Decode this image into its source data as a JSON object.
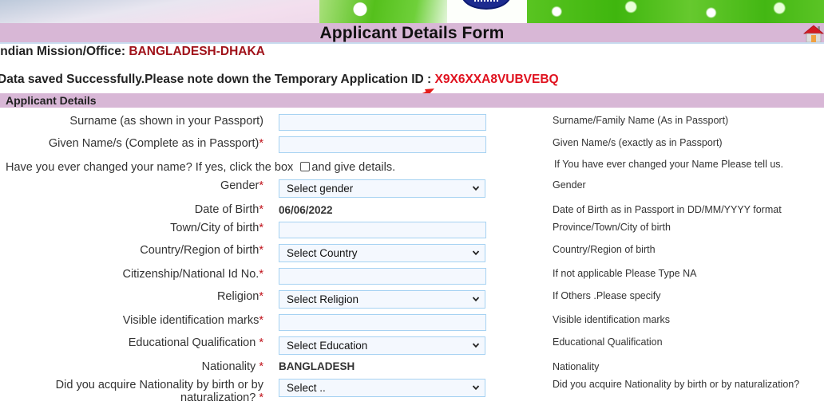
{
  "page": {
    "title": "Applicant Details Form",
    "home_icon": "home-icon"
  },
  "mission": {
    "label": "Indian Mission/Office: ",
    "value": "BANGLADESH-DHAKA"
  },
  "save_message": {
    "text": "Data saved Successfully.Please note down the Temporary Application ID : ",
    "application_id": "X9X6XXA8VUBVEBQ",
    "arrow_icon": "red-arrow-annotation"
  },
  "section": {
    "title": "Applicant Details"
  },
  "colors": {
    "accent_bar": "#d8b7d6",
    "mission_value": "#a0121a",
    "application_id": "#e0121f",
    "input_border": "#a6d2f2",
    "input_bg": "#f4f8fe"
  },
  "fields": {
    "surname": {
      "label": "Surname (as shown in your Passport)",
      "required": "",
      "value": "",
      "help": "Surname/Family Name (As in Passport)"
    },
    "given_name": {
      "label": "Given Name/s (Complete as in Passport)",
      "required": "*",
      "value": "",
      "help": "Given Name/s (exactly as in Passport)"
    },
    "name_changed": {
      "label_before": "Have you ever changed your name? If yes, click the box ",
      "label_after": "and give details.",
      "checked": false,
      "help": "If You have ever changed your Name Please tell us."
    },
    "gender": {
      "label": "Gender",
      "required": "*",
      "selected": "Select gender",
      "help": "Gender"
    },
    "dob": {
      "label": "Date of Birth",
      "required": "*",
      "value": "06/06/2022",
      "help": "Date of Birth as in Passport in DD/MM/YYYY format"
    },
    "town_of_birth": {
      "label": "Town/City of birth",
      "required": "*",
      "value": "",
      "help": "Province/Town/City of birth"
    },
    "country_of_birth": {
      "label": "Country/Region of birth",
      "required": "*",
      "selected": "Select Country",
      "help": "Country/Region of birth"
    },
    "national_id": {
      "label": "Citizenship/National Id No.",
      "required": "*",
      "value": "",
      "help": "If not applicable Please Type NA"
    },
    "religion": {
      "label": "Religion",
      "required": "*",
      "selected": "Select Religion",
      "help": "If Others .Please specify"
    },
    "identification_marks": {
      "label": "Visible identification marks",
      "required": "*",
      "value": "",
      "help": "Visible identification marks"
    },
    "education": {
      "label": "Educational Qualification ",
      "required": "*",
      "selected": "Select Education",
      "help": "Educational Qualification"
    },
    "nationality": {
      "label": "Nationality ",
      "required": "*",
      "value": "BANGLADESH",
      "help": "Nationality"
    },
    "nationality_acquired": {
      "label_line1": "Did you acquire Nationality by birth or by",
      "label_line2": "naturalization? ",
      "required": "*",
      "selected": "Select ..",
      "help": "Did you acquire Nationality by birth or by naturalization?"
    }
  }
}
